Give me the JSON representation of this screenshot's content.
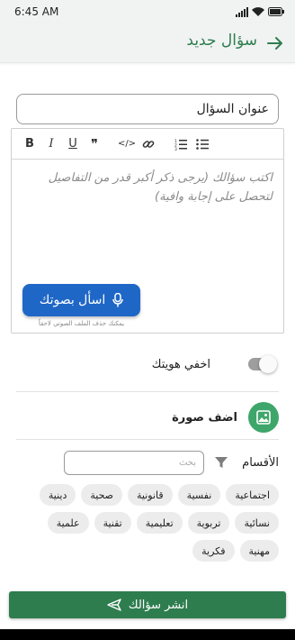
{
  "status_bar": {
    "time": "6:45 AM"
  },
  "app_bar": {
    "title": "سؤال جديد"
  },
  "form": {
    "title_value": "عنوان السؤال",
    "editor_placeholder_line1": "اكتب سؤالك (يرجى ذكر أكبر قدر من التفاصيل",
    "editor_placeholder_line2": "لتحصل على إجابة وافية)",
    "toolbar": {
      "bold": "B",
      "italic": "I",
      "underline": "U",
      "quote": "❞",
      "code": "</>"
    },
    "voice_button": "اسأل بصوتك",
    "voice_hint": "يمكنك حذف الملف الصوتي لاحقاً",
    "hide_identity": "اخفي هويتك",
    "add_photo": "اضف صورة",
    "categories_label": "الأقسام",
    "search_placeholder": "بحث",
    "categories": [
      "اجتماعية",
      "نفسية",
      "قانونية",
      "صحية",
      "دينية",
      "نسائية",
      "تربوية",
      "تعليمية",
      "تقنية",
      "علمية",
      "مهنية",
      "فكرية"
    ],
    "publish_button": "انشر سؤالك"
  },
  "colors": {
    "primary_green": "#2e7d4f",
    "voice_blue": "#1f67c7",
    "photo_green": "#3ea66a"
  },
  "toggle": {
    "hide_identity_on": false
  }
}
